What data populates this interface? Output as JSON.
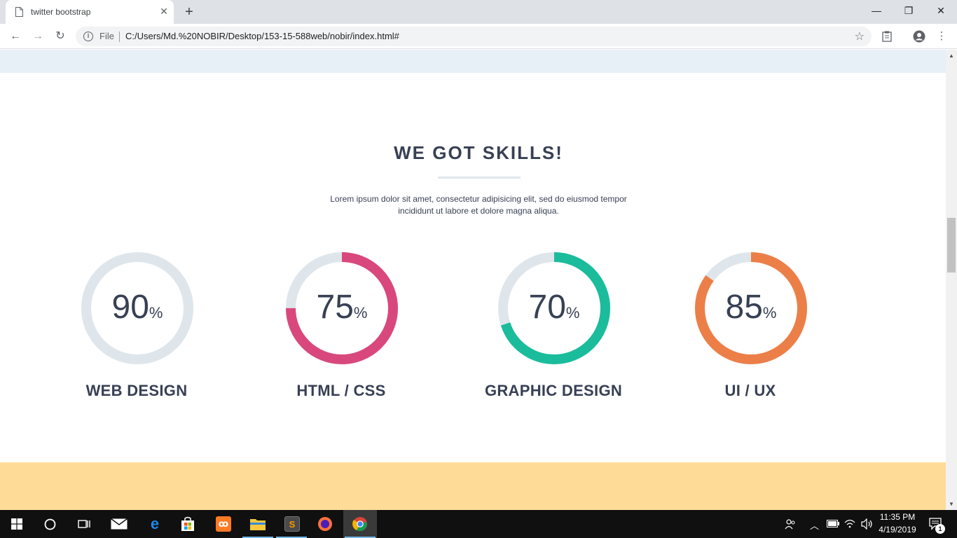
{
  "browser": {
    "tab_title": "twitter bootstrap",
    "tab_close": "✕",
    "new_tab": "+",
    "minimize": "—",
    "restore": "❐",
    "close": "✕",
    "back": "←",
    "forward": "→",
    "reload": "↻",
    "scheme_label": "File",
    "url": "C:/Users/Md.%20NOBIR/Desktop/153-15-588web/nobir/index.html#",
    "bookmark_star": "☆",
    "menu": "⋮"
  },
  "page": {
    "skills_title": "WE GOT SKILLS!",
    "skills_desc": "Lorem ipsum dolor sit amet, consectetur adipisicing elit, sed do eiusmod tempor incididunt ut labore et dolore magna aliqua.",
    "skills": [
      {
        "name": "WEB DESIGN",
        "percent": 90,
        "percent_text": "90",
        "unit": "%",
        "color": "#dfe6eb"
      },
      {
        "name": "HTML / CSS",
        "percent": 75,
        "percent_text": "75",
        "unit": "%",
        "color": "#d9487d"
      },
      {
        "name": "GRAPHIC DESIGN",
        "percent": 70,
        "percent_text": "70",
        "unit": "%",
        "color": "#1abc9c"
      },
      {
        "name": "UI / UX",
        "percent": 85,
        "percent_text": "85",
        "unit": "%",
        "color": "#ec7f48"
      }
    ],
    "track_color": "#dfe6eb",
    "top_band_color": "#e7eff7",
    "bottom_band_color": "#fedc98"
  },
  "taskbar": {
    "time": "11:35 PM",
    "date": "4/19/2019",
    "notification_count": "1",
    "apps": [
      "windows-start-icon",
      "cortana-icon",
      "task-view-icon",
      "mail-icon",
      "edge-icon",
      "store-icon",
      "xampp-icon",
      "file-explorer-icon",
      "sublime-text-icon",
      "firefox-icon",
      "chrome-icon"
    ]
  }
}
